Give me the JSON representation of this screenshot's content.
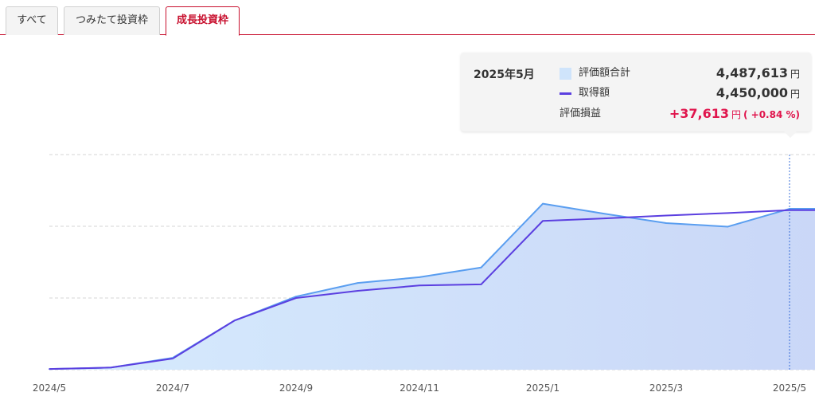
{
  "tabs": [
    {
      "label": "すべて",
      "active": false
    },
    {
      "label": "つみたて投資枠",
      "active": false
    },
    {
      "label": "成長投資枠",
      "active": true
    }
  ],
  "tooltip": {
    "date": "2025年5月",
    "rows": [
      {
        "label": "評価額合計",
        "value": "4,487,613",
        "unit": "円"
      },
      {
        "label": "取得額",
        "value": "4,450,000",
        "unit": "円"
      },
      {
        "label": "評価損益",
        "value": "+37,613",
        "unit": "円",
        "pct": "( +0.84 %)"
      }
    ]
  },
  "colors": {
    "accent": "#c8102e",
    "evaluation_line": "#5a9ef0",
    "evaluation_fill": "#cfe4fb",
    "acquisition_line": "#5b3fe0",
    "positive": "#e0144c"
  },
  "chart_data": {
    "type": "area",
    "x": [
      "2024/5",
      "2024/6",
      "2024/7",
      "2024/8",
      "2024/9",
      "2024/10",
      "2024/11",
      "2024/12",
      "2025/1",
      "2025/2",
      "2025/3",
      "2025/4",
      "2025/5",
      "2025/6"
    ],
    "xticks": [
      "2024/5",
      "2024/7",
      "2024/9",
      "2024/11",
      "2025/1",
      "2025/3",
      "2025/5"
    ],
    "series": [
      {
        "name": "評価額合計",
        "values": [
          20000,
          60000,
          330000,
          1370000,
          2040000,
          2420000,
          2580000,
          2850000,
          4630000,
          4350000,
          4090000,
          3990000,
          4487613,
          4487613
        ]
      },
      {
        "name": "取得額",
        "values": [
          20000,
          60000,
          310000,
          1370000,
          2000000,
          2200000,
          2350000,
          2380000,
          4150000,
          4220000,
          4300000,
          4370000,
          4450000,
          4450000
        ]
      }
    ],
    "ylim": [
      0,
      6000000
    ],
    "grid": true,
    "highlight_index": 12
  }
}
